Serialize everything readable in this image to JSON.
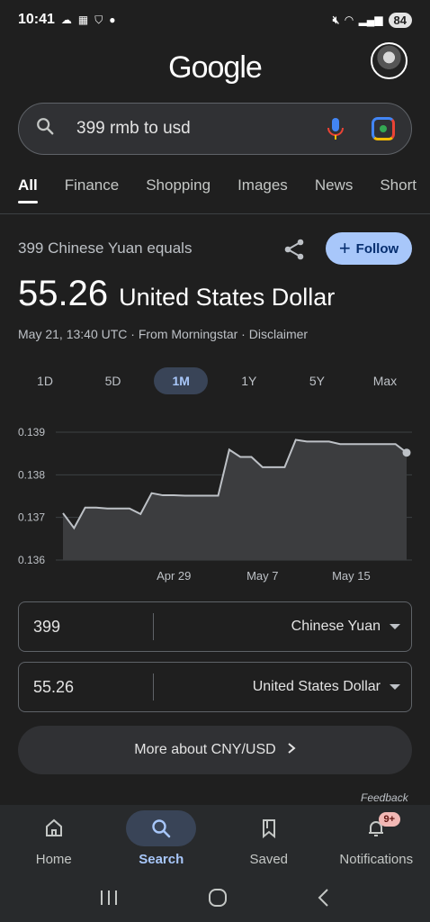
{
  "status_bar": {
    "time": "10:41",
    "battery": "84",
    "icons_left": [
      "cloud-icon",
      "calendar-icon",
      "vpn-shield-icon",
      "dot-icon"
    ],
    "icons_right": [
      "mute-icon",
      "wifi-icon",
      "signal-icon"
    ]
  },
  "header": {
    "logo": "Google"
  },
  "search": {
    "query": "399 rmb to usd"
  },
  "tabs": [
    {
      "label": "All",
      "active": true
    },
    {
      "label": "Finance"
    },
    {
      "label": "Shopping"
    },
    {
      "label": "Images"
    },
    {
      "label": "News"
    },
    {
      "label": "Short"
    }
  ],
  "conversion": {
    "equals_label": "399 Chinese Yuan equals",
    "follow_label": "Follow",
    "amount": "55.26",
    "currency": "United States Dollar",
    "meta": "May 21, 13:40 UTC · From Morningstar · Disclaimer"
  },
  "ranges": [
    "1D",
    "5D",
    "1M",
    "1Y",
    "5Y",
    "Max"
  ],
  "active_range": "1M",
  "chart_data": {
    "type": "area",
    "y_ticks": [
      "0.139",
      "0.138",
      "0.137",
      "0.136"
    ],
    "ylim": [
      0.136,
      0.139
    ],
    "x_ticks": [
      {
        "label": "Apr 29",
        "x": 10
      },
      {
        "label": "May 7",
        "x": 18
      },
      {
        "label": "May 15",
        "x": 26
      }
    ],
    "x": [
      0,
      1,
      2,
      3,
      4,
      5,
      6,
      7,
      8,
      9,
      10,
      11,
      12,
      13,
      14,
      15,
      16,
      17,
      18,
      19,
      20,
      21,
      22,
      23,
      24,
      25,
      26,
      27,
      28,
      29,
      30,
      31
    ],
    "values": [
      0.1371,
      0.13675,
      0.13723,
      0.13723,
      0.13721,
      0.13721,
      0.13721,
      0.13708,
      0.13757,
      0.13752,
      0.13752,
      0.13751,
      0.13751,
      0.13751,
      0.13751,
      0.13859,
      0.13842,
      0.13842,
      0.13818,
      0.13818,
      0.13818,
      0.13882,
      0.13878,
      0.13878,
      0.13878,
      0.13872,
      0.13872,
      0.13872,
      0.13872,
      0.13872,
      0.13872,
      0.13852
    ],
    "line_color": "#bdc1c6",
    "fill_color": "#3c3d3f"
  },
  "converter": {
    "from_value": "399",
    "from_unit": "Chinese Yuan",
    "to_value": "55.26",
    "to_unit": "United States Dollar"
  },
  "more_about": "More about CNY/USD",
  "feedback": "Feedback",
  "bottom_nav": [
    {
      "label": "Home",
      "icon": "home-icon"
    },
    {
      "label": "Search",
      "icon": "search-icon",
      "active": true
    },
    {
      "label": "Saved",
      "icon": "bookmark-icon"
    },
    {
      "label": "Notifications",
      "icon": "bell-icon",
      "badge": "9+"
    }
  ],
  "colors": {
    "background": "#1f1f1f",
    "accent": "#a8c7fa"
  }
}
